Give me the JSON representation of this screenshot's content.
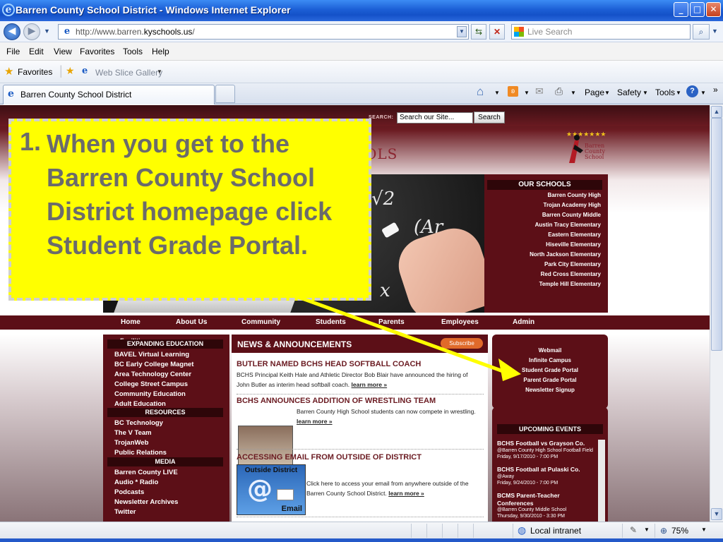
{
  "window": {
    "title": "Barren County School District - Windows Internet Explorer",
    "minimize": "_",
    "maximize": "□",
    "close": "✕"
  },
  "address": {
    "url_prefix": "http://www.barren.",
    "url_host": "kyschools.us",
    "url_suffix": "/",
    "search_placeholder": "Live Search"
  },
  "menu": [
    "File",
    "Edit",
    "View",
    "Favorites",
    "Tools",
    "Help"
  ],
  "favorites_bar": {
    "favorites_label": "Favorites",
    "web_slice_label": "Web Slice Gallery"
  },
  "tabs": {
    "active_tab": "Barren County School District"
  },
  "command_bar": {
    "page": "Page",
    "safety": "Safety",
    "tools": "Tools"
  },
  "site": {
    "search_label": "SEARCH:",
    "search_value": "Search our Site...",
    "search_button": "Search",
    "logo_fragment": "OLS",
    "our_schools": {
      "title": "OUR SCHOOLS",
      "items": [
        "Barren County High",
        "Trojan Academy High",
        "Barren County Middle",
        "Austin Tracy Elementary",
        "Eastern Elementary",
        "Hiseville Elementary",
        "North Jackson Elementary",
        "Park City Elementary",
        "Red Cross Elementary",
        "Temple Hill Elementary"
      ]
    },
    "nav": [
      "Home",
      "About Us",
      "Community",
      "Students",
      "Parents",
      "Employees",
      "Admin"
    ],
    "left_nav": {
      "faculties": "Facilities",
      "expanding_title": "EXPANDING EDUCATION",
      "expanding_items": [
        "BAVEL Virtual Learning",
        "BC Early College Magnet",
        "Area Technology Center",
        "College Street Campus",
        "Community Education",
        "Adult Education"
      ],
      "resources_title": "RESOURCES",
      "resources_items": [
        "BC Technology",
        "The V Team",
        "TrojanWeb",
        "Public Relations"
      ],
      "media_title": "MEDIA",
      "media_items": [
        "Barren County LIVE",
        "Audio * Radio",
        "Podcasts",
        "Newsletter Archives",
        "Twitter"
      ]
    },
    "news": {
      "title": "NEWS & ANNOUNCEMENTS",
      "subscribe": "Subscribe",
      "items": [
        {
          "headline": "BUTLER NAMED BCHS HEAD SOFTBALL COACH",
          "body": "BCHS Principal Keith Hale and Athletic Director Bob Blair have announced the hiring of John Butler as interim head softball coach.",
          "more": "learn more »"
        },
        {
          "headline": "BCHS ANNOUNCES ADDITION OF WRESTLING TEAM",
          "body": "Barren County High School students can now compete in wrestling.",
          "more": "learn more »"
        },
        {
          "headline": "ACCESSING EMAIL FROM OUTSIDE OF DISTRICT",
          "body": "Click here to access your email from anywhere outside of the Barren County School District.",
          "more": "learn more »",
          "image_caption_top": "Outside District",
          "image_caption_bottom": "Email"
        }
      ]
    },
    "quick_links": [
      "Webmail",
      "Infinite Campus",
      "Student Grade Portal",
      "Parent Grade Portal",
      "Newsletter Signup"
    ],
    "events": {
      "title": "UPCOMING EVENTS",
      "items": [
        {
          "title": "BCHS Football vs Grayson Co.",
          "place": "@Barren County High School Football Field",
          "date": "Friday, 9/17/2010 - 7:00 PM"
        },
        {
          "title": "BCHS Football at Pulaski Co.",
          "place": "@Away",
          "date": "Friday, 9/24/2010 - 7:00 PM"
        },
        {
          "title": "BCMS Parent-Teacher Conferences",
          "place": "@Barren County Middle School",
          "date": "Thursday, 9/30/2010 - 3:30 PM"
        }
      ]
    }
  },
  "callout": {
    "number": "1.",
    "text": "When you get to the Barren County School District homepage click Student Grade Portal."
  },
  "status": {
    "zone": "Local intranet",
    "zoom": "75%"
  },
  "colors": {
    "maroon": "#5c0f17",
    "callout_yellow": "#ffff00",
    "ie_blue": "#1c5fd6"
  }
}
